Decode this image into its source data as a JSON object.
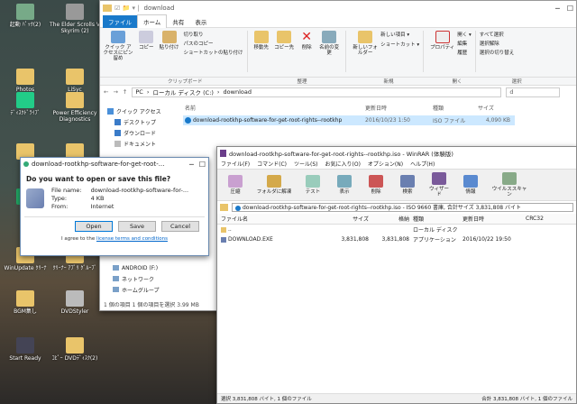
{
  "desktop": {
    "icons": [
      {
        "label": "起動 ﾊﾟｯｸ(2)",
        "color": "#7a8"
      },
      {
        "label": "The Elder Scrolls V Skyrim (2)",
        "color": "#999"
      },
      {
        "label": "Photos",
        "color": "#e9c46a"
      },
      {
        "label": "LiSyc",
        "color": "#e9c46a"
      },
      {
        "label": "ﾃﾞｨｽｸﾄﾞﾗｲﾌﾞ",
        "color": "#2c8"
      },
      {
        "label": "Power Efficiency Diagnostics",
        "color": "#e9c46a"
      },
      {
        "label": "",
        "color": "#e9c46a"
      },
      {
        "label": "",
        "color": "#e9c46a"
      },
      {
        "label": "",
        "color": "#2a6"
      },
      {
        "label": "",
        "color": "#e9c46a"
      },
      {
        "label": "WinUpdate ｸﾘｰﾅ",
        "color": "#e9c46a"
      },
      {
        "label": "ｸﾘｰﾅｰ ｱﾌﾟﾘ ｸﾞﾙｰﾌﾟ",
        "color": "#e9c46a"
      },
      {
        "label": "BGM集し",
        "color": "#e9c46a"
      },
      {
        "label": "DVDStyler",
        "color": "#bbb"
      },
      {
        "label": "Start Ready",
        "color": "#445"
      },
      {
        "label": "ｺﾋﾟｰ DVDﾃﾞｨｽｸ(2)",
        "color": "#e9c46a"
      }
    ]
  },
  "explorer": {
    "title": "download",
    "tabs": [
      "ファイル",
      "ホーム",
      "共有",
      "表示"
    ],
    "ribbon": {
      "clipboard": {
        "label": "クリップボード",
        "pin": "クイック アクセスにピン留め",
        "copy": "コピー",
        "paste": "貼り付け",
        "cut": "切り取り",
        "copy_path": "パスのコピー",
        "paste_shortcut": "ショートカットの貼り付け"
      },
      "organize": {
        "label": "整理",
        "move": "移動先",
        "copy_to": "コピー先",
        "delete": "削除",
        "rename": "名前の変更"
      },
      "new": {
        "label": "新規",
        "new_folder": "新しいフォルダー",
        "new_item": "新しい項目 ▾",
        "shortcut": "ショートカット ▾"
      },
      "open": {
        "label": "開く",
        "properties": "プロパティ",
        "open": "開く ▾",
        "edit": "編集",
        "history": "履歴"
      },
      "select": {
        "label": "選択",
        "all": "すべて選択",
        "none": "選択解除",
        "invert": "選択の切り替え"
      }
    },
    "breadcrumb": [
      "PC",
      "ローカル ディスク (C:)",
      "download"
    ],
    "search_placeholder": "d",
    "sidebar": [
      "クイック アクセス",
      "デスクトップ",
      "ダウンロード",
      "ドキュメント"
    ],
    "sidebar_lower": [
      "ANDROID (F:)",
      "ネットワーク",
      "ホームグループ"
    ],
    "columns": [
      "名前",
      "更新日時",
      "種類",
      "サイズ"
    ],
    "files": [
      {
        "name": "download-rootkhp-software-for-get-root-rights--rootkhp",
        "date": "2016/10/23 1:50",
        "type": "ISO ファイル",
        "size": "4,090 KB"
      }
    ],
    "status": "1 個の項目   1 個の項目を選択  3.99 MB"
  },
  "dialog": {
    "title": "download-rootkhp-software-for-get-root-...",
    "question": "Do you want to open or save this file?",
    "labels": {
      "name": "File name:",
      "type": "Type:",
      "from": "From:"
    },
    "values": {
      "name": "download-rootkhp-software-for-...",
      "type": "4 KB",
      "from": "Internet"
    },
    "buttons": {
      "open": "Open",
      "save": "Save",
      "cancel": "Cancel"
    },
    "footer_pre": "I agree to the ",
    "footer_link": "license terms and conditions"
  },
  "winrar": {
    "title": "download-rootkhp-software-for-get-root-rights--rootkhp.iso - WinRAR (体験版)",
    "menu": [
      "ファイル(F)",
      "コマンド(C)",
      "ツール(S)",
      "お気に入り(O)",
      "オプション(N)",
      "ヘルプ(H)"
    ],
    "toolbar": [
      "圧縮",
      "フォルダに解凍",
      "テスト",
      "表示",
      "削除",
      "検索",
      "ウィザード",
      "情報",
      "ウイルススキャン"
    ],
    "address": "download-rootkhp-software-for-get-root-rights--rootkhp.iso - ISO 9660 書庫, 合計サイズ 3,831,808 バイト",
    "columns": [
      "ファイル名",
      "サイズ",
      "格納",
      "種類",
      "更新日時",
      "CRC32"
    ],
    "rows": [
      {
        "name": "..",
        "size": "",
        "packed": "",
        "type": "ローカル ディスク",
        "date": "",
        "crc": ""
      },
      {
        "name": "DOWNLOAD.EXE",
        "size": "3,831,808",
        "packed": "3,831,808",
        "type": "アプリケーション",
        "date": "2016/10/22 19:50",
        "crc": ""
      }
    ],
    "status_left": "選択 3,831,808 バイト, 1 個のファイル",
    "status_right": "合計 3,831,808 バイト, 1 個のファイル"
  },
  "colors": {
    "accent": "#1979ca",
    "selection": "#cce8ff",
    "winrar_purple": "#6a3d8a"
  }
}
